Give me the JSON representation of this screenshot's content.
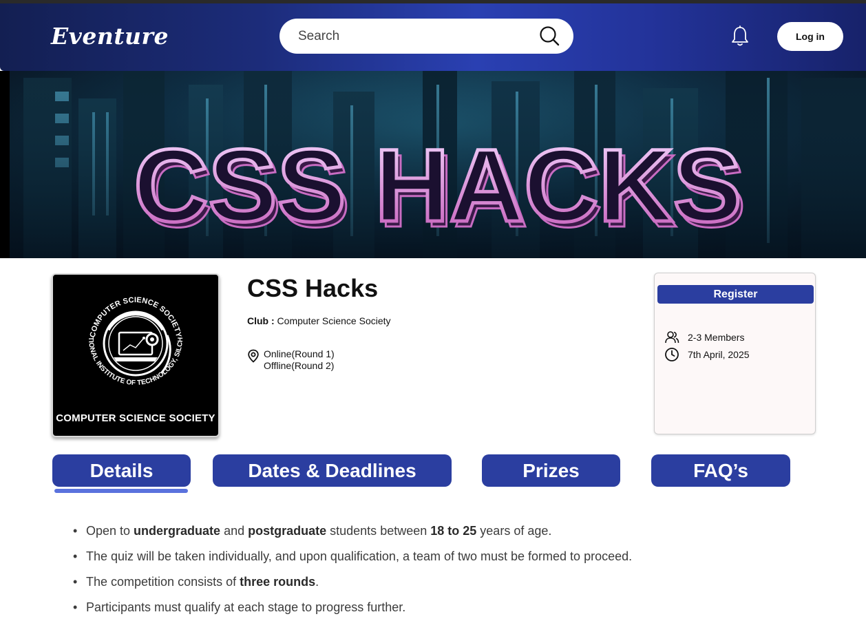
{
  "header": {
    "logo": "Eventure",
    "search_placeholder": "Search",
    "login_label": "Log in"
  },
  "banner": {
    "title": "CSS HACKS"
  },
  "club_card": {
    "caption": "COMPUTER SCIENCE SOCIETY",
    "seal_top_text": "COMPUTER SCIENCE SOCIETY",
    "seal_bottom_text": "NATIONAL INSTITUTE OF TECHNOLOGY, SILCHAR"
  },
  "event": {
    "title": "CSS Hacks",
    "club_label": "Club :",
    "club_name": "Computer Science Society",
    "location_line1": "Online(Round 1)",
    "location_line2": "Offline(Round 2)"
  },
  "registration": {
    "button_label": "Register",
    "team_size": "2-3 Members",
    "date": "7th April, 2025"
  },
  "tabs": [
    {
      "label": "Details",
      "active": true
    },
    {
      "label": "Dates & Deadlines",
      "active": false
    },
    {
      "label": "Prizes",
      "active": false
    },
    {
      "label": "FAQ’s",
      "active": false
    }
  ],
  "details": [
    {
      "parts": [
        {
          "text": "Open to ",
          "bold": false
        },
        {
          "text": "undergraduate",
          "bold": true
        },
        {
          "text": " and ",
          "bold": false
        },
        {
          "text": "postgraduate",
          "bold": true
        },
        {
          "text": " students between ",
          "bold": false
        },
        {
          "text": "18 to 25",
          "bold": true
        },
        {
          "text": " years of age.",
          "bold": false
        }
      ]
    },
    {
      "parts": [
        {
          "text": "The quiz will be taken individually, and upon qualification, a team of two must be formed to proceed.",
          "bold": false
        }
      ]
    },
    {
      "parts": [
        {
          "text": "The competition consists of ",
          "bold": false
        },
        {
          "text": "three rounds",
          "bold": true
        },
        {
          "text": ".",
          "bold": false
        }
      ]
    },
    {
      "parts": [
        {
          "text": "Participants must qualify at each stage to progress further.",
          "bold": false
        }
      ]
    }
  ],
  "colors": {
    "primary": "#2b3ea0",
    "tab_underline": "#5a72dd",
    "header_dark": "#131f52"
  }
}
